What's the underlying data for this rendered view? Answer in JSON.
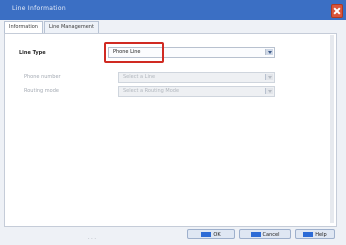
{
  "window": {
    "title": "Line Information"
  },
  "tabs": [
    {
      "label": "Information"
    },
    {
      "label": "Line Management"
    }
  ],
  "form": {
    "line_type": {
      "label": "Line Type",
      "value": "Phone Line"
    },
    "phone_number": {
      "label": "Phone number",
      "value": "Select a Line"
    },
    "routing_mode": {
      "label": "Routing mode",
      "value": "Select a Routing Mode"
    }
  },
  "buttons": {
    "ok": "OK",
    "cancel": "Cancel",
    "help": "Help"
  },
  "colors": {
    "title_bar": "#3b6fc4",
    "highlight": "#d02a22"
  }
}
